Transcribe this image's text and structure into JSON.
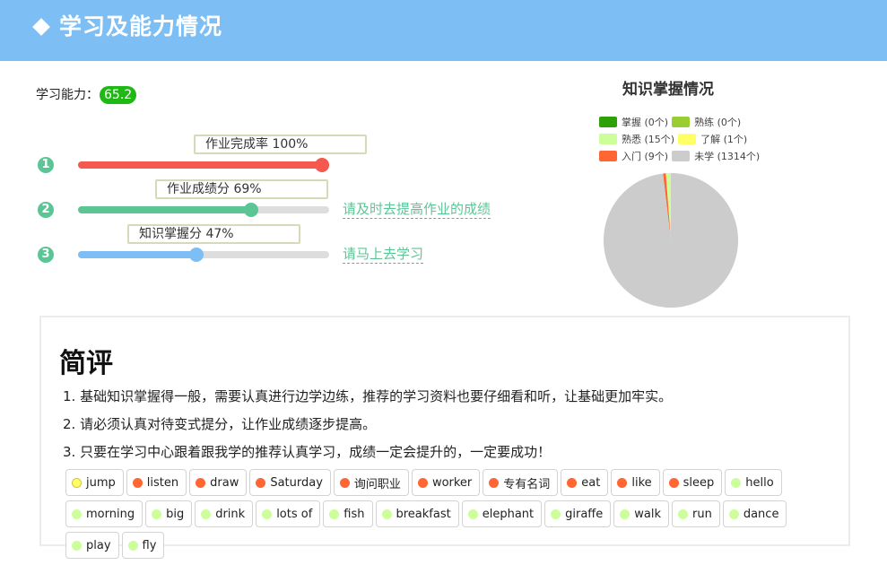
{
  "header": {
    "title": "学习及能力情况",
    "icon": "diamond-icon"
  },
  "ability": {
    "label": "学习能力：",
    "value": "65.2",
    "badge_color": "#1fb814"
  },
  "progress": [
    {
      "num": "1",
      "label": "作业完成率 100%",
      "percent": 100,
      "color": "#f5584f",
      "hint": ""
    },
    {
      "num": "2",
      "label": "作业成绩分 69%",
      "percent": 69,
      "color": "#5cc596",
      "hint": "请及时去提高作业的成绩"
    },
    {
      "num": "3",
      "label": "知识掌握分 47%",
      "percent": 47,
      "color": "#7dbff5",
      "hint": "请马上去学习"
    }
  ],
  "chart_data": {
    "type": "pie",
    "title": "知识掌握情况",
    "legend_position": "top",
    "slices": [
      {
        "name": "掌握",
        "value": 0,
        "color": "#2ea10a",
        "label": "掌握 (0个)"
      },
      {
        "name": "熟练",
        "value": 0,
        "color": "#9acd32",
        "label": "熟练 (0个)"
      },
      {
        "name": "熟悉",
        "value": 15,
        "color": "#ccff99",
        "label": "熟悉 (15个)"
      },
      {
        "name": "了解",
        "value": 1,
        "color": "#ffff66",
        "label": "了解 (1个)"
      },
      {
        "name": "入门",
        "value": 9,
        "color": "#ff6633",
        "label": "入门 (9个)"
      },
      {
        "name": "未学",
        "value": 1314,
        "color": "#cccccc",
        "label": "未学 (1314个)"
      }
    ]
  },
  "review": {
    "title": "简评",
    "lines": [
      "1. 基础知识掌握得一般，需要认真进行边学边练，推荐的学习资料也要仔细看和听，让基础更加牢实。",
      "2. 请必须认真对待变式提分，让作业成绩逐步提高。",
      "3. 只要在学习中心跟着跟我学的推荐认真学习，成绩一定会提升的，一定要成功！"
    ],
    "tags": [
      {
        "text": "jump",
        "color": "#ffff66"
      },
      {
        "text": "listen",
        "color": "#ff6633"
      },
      {
        "text": "draw",
        "color": "#ff6633"
      },
      {
        "text": "Saturday",
        "color": "#ff6633"
      },
      {
        "text": "询问职业",
        "color": "#ff6633"
      },
      {
        "text": "worker",
        "color": "#ff6633"
      },
      {
        "text": "专有名词",
        "color": "#ff6633"
      },
      {
        "text": "eat",
        "color": "#ff6633"
      },
      {
        "text": "like",
        "color": "#ff6633"
      },
      {
        "text": "sleep",
        "color": "#ff6633"
      },
      {
        "text": "hello",
        "color": "#ccff99"
      },
      {
        "text": "morning",
        "color": "#ccff99"
      },
      {
        "text": "big",
        "color": "#ccff99"
      },
      {
        "text": "drink",
        "color": "#ccff99"
      },
      {
        "text": "lots of",
        "color": "#ccff99"
      },
      {
        "text": "fish",
        "color": "#ccff99"
      },
      {
        "text": "breakfast",
        "color": "#ccff99"
      },
      {
        "text": "elephant",
        "color": "#ccff99"
      },
      {
        "text": "giraffe",
        "color": "#ccff99"
      },
      {
        "text": "walk",
        "color": "#ccff99"
      },
      {
        "text": "run",
        "color": "#ccff99"
      },
      {
        "text": "dance",
        "color": "#ccff99"
      },
      {
        "text": "play",
        "color": "#ccff99"
      },
      {
        "text": "fly",
        "color": "#ccff99"
      }
    ]
  }
}
